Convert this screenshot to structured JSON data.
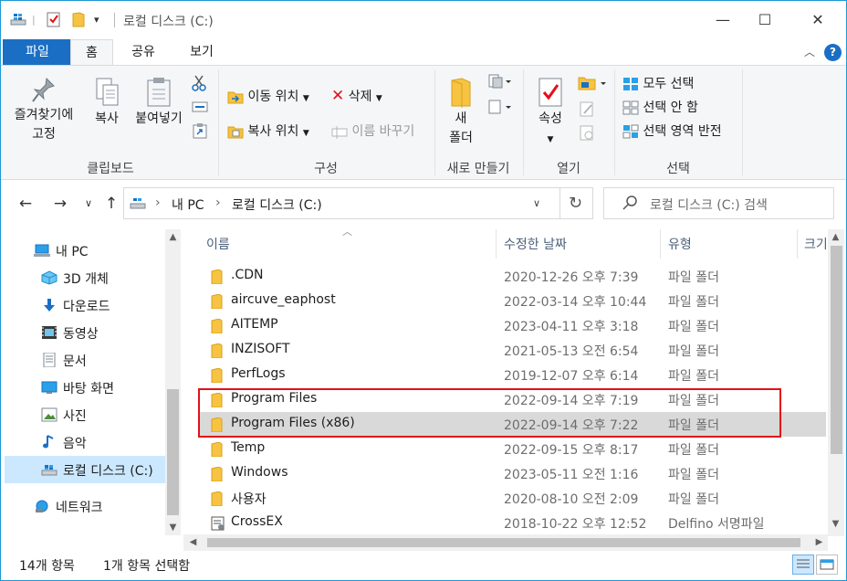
{
  "window": {
    "title": "로컬 디스크 (C:)",
    "minimize": "—",
    "maximize": "☐",
    "close": "✕"
  },
  "tabs": [
    "파일",
    "홈",
    "공유",
    "보기"
  ],
  "ribbon": {
    "clipboard": {
      "pin_label": "즐겨찾기에",
      "pin_label2": "고정",
      "copy": "복사",
      "paste": "붙여넣기",
      "group": "클립보드"
    },
    "organize": {
      "move_to": "이동 위치",
      "copy_to": "복사 위치",
      "delete": "삭제",
      "rename": "이름 바꾸기",
      "group": "구성"
    },
    "new": {
      "new_folder": "새",
      "new_folder2": "폴더",
      "group": "새로 만들기"
    },
    "open": {
      "properties": "속성",
      "group": "열기"
    },
    "select": {
      "select_all": "모두 선택",
      "select_none": "선택 안 함",
      "invert": "선택 영역 반전",
      "group": "선택"
    }
  },
  "address": {
    "segments": [
      "내 PC",
      "로컬 디스크 (C:)"
    ],
    "search_placeholder": "로컬 디스크 (C:) 검색"
  },
  "nav_pane": {
    "items": [
      {
        "label": "내 PC",
        "icon": "pc-icon"
      },
      {
        "label": "3D 개체",
        "icon": "3d-objects-icon"
      },
      {
        "label": "다운로드",
        "icon": "download-icon"
      },
      {
        "label": "동영상",
        "icon": "video-icon"
      },
      {
        "label": "문서",
        "icon": "document-icon"
      },
      {
        "label": "바탕 화면",
        "icon": "desktop-icon"
      },
      {
        "label": "사진",
        "icon": "pictures-icon"
      },
      {
        "label": "음악",
        "icon": "music-icon"
      },
      {
        "label": "로컬 디스크 (C:)",
        "icon": "drive-icon"
      },
      {
        "label": "네트워크",
        "icon": "network-icon"
      }
    ]
  },
  "file_list": {
    "columns": [
      "이름",
      "수정한 날짜",
      "유형",
      "크기"
    ],
    "rows": [
      {
        "name": ".CDN",
        "date": "2020-12-26 오후 7:39",
        "type": "파일 폴더"
      },
      {
        "name": "aircuve_eaphost",
        "date": "2022-03-14 오후 10:44",
        "type": "파일 폴더"
      },
      {
        "name": "AITEMP",
        "date": "2023-04-11 오후 3:18",
        "type": "파일 폴더"
      },
      {
        "name": "INZISOFT",
        "date": "2021-05-13 오전 6:54",
        "type": "파일 폴더"
      },
      {
        "name": "PerfLogs",
        "date": "2019-12-07 오후 6:14",
        "type": "파일 폴더"
      },
      {
        "name": "Program Files",
        "date": "2022-09-14 오후 7:19",
        "type": "파일 폴더"
      },
      {
        "name": "Program Files (x86)",
        "date": "2022-09-14 오후 7:22",
        "type": "파일 폴더"
      },
      {
        "name": "Temp",
        "date": "2022-09-15 오후 8:17",
        "type": "파일 폴더"
      },
      {
        "name": "Windows",
        "date": "2023-05-11 오전 1:16",
        "type": "파일 폴더"
      },
      {
        "name": "사용자",
        "date": "2020-08-10 오전 2:09",
        "type": "파일 폴더"
      },
      {
        "name": "CrossEX",
        "date": "2018-10-22 오후 12:52",
        "type": "Delfino 서명파일"
      }
    ]
  },
  "status": {
    "count": "14개 항목",
    "selected": "1개 항목 선택함"
  },
  "colors": {
    "accent": "#1a6fc4",
    "selection": "#d9d9d9",
    "highlight_box": "#e3101a",
    "folder": "#f6c342"
  }
}
